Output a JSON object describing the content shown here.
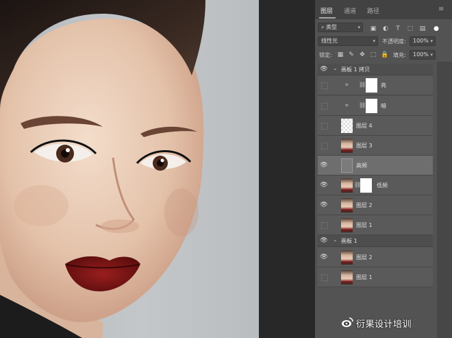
{
  "tabs": [
    {
      "label": "图层",
      "active": true
    },
    {
      "label": "通道",
      "active": false
    },
    {
      "label": "路径",
      "active": false
    }
  ],
  "filter": {
    "kind_label": "类型",
    "search_symbol": "⌕",
    "icons": [
      "image-filter-icon",
      "adjustment-filter-icon",
      "type-filter-icon",
      "shape-filter-icon",
      "smart-object-filter-icon"
    ]
  },
  "blend": {
    "mode": "线性光",
    "opacity_label": "不透明度:",
    "opacity_value": "100%"
  },
  "lock": {
    "label": "锁定:",
    "fill_label": "填充:",
    "fill_value": "100%"
  },
  "layers": [
    {
      "name": "画板 1 拷贝",
      "type": "group",
      "visible": true,
      "selected": false
    },
    {
      "name": "亮",
      "type": "curves",
      "visible": false,
      "selected": false
    },
    {
      "name": "暗",
      "type": "curves",
      "visible": false,
      "selected": false
    },
    {
      "name": "图层 4",
      "type": "transparent",
      "visible": false,
      "selected": false
    },
    {
      "name": "图层 3",
      "type": "photo",
      "visible": false,
      "selected": false
    },
    {
      "name": "高频",
      "type": "gray",
      "visible": true,
      "selected": true
    },
    {
      "name": "低频",
      "type": "photo-mask",
      "visible": true,
      "selected": false
    },
    {
      "name": "图层 2",
      "type": "photo",
      "visible": true,
      "selected": false
    },
    {
      "name": "图层 1",
      "type": "photo",
      "visible": false,
      "selected": false
    },
    {
      "name": "画板 1",
      "type": "group",
      "visible": true,
      "selected": false
    },
    {
      "name": "图层 2",
      "type": "photo",
      "visible": true,
      "selected": false
    },
    {
      "name": "图层 1",
      "type": "photo",
      "visible": false,
      "selected": false
    }
  ],
  "watermark": "衍果设计培训",
  "colors": {
    "panel": "#535353",
    "lips": "#7a1515",
    "canvas_bg": "#bfc3c5"
  }
}
